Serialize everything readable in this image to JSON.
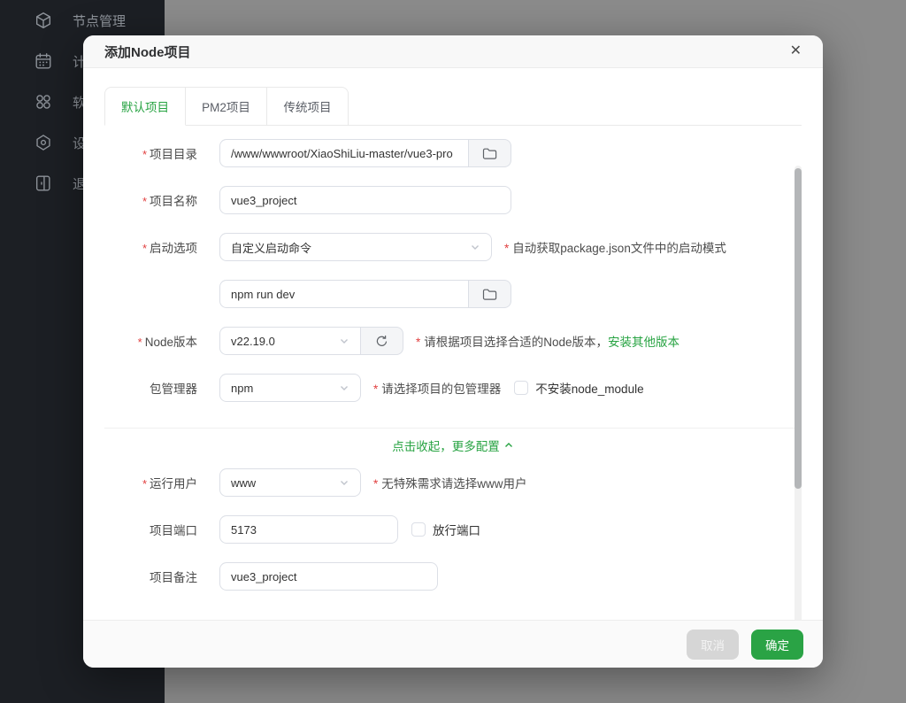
{
  "colors": {
    "accent": "#27a342",
    "required": "#e13f3f",
    "confirm_button": "#2aa345",
    "sidebar_bg": "#1c1f24"
  },
  "sidebar": {
    "items": [
      {
        "label": "节点管理",
        "icon": "cube-icon"
      },
      {
        "label": "计划",
        "icon": "calendar-icon"
      },
      {
        "label": "软件",
        "icon": "apps-icon"
      },
      {
        "label": "设置",
        "icon": "settings-icon"
      },
      {
        "label": "退出",
        "icon": "logout-icon"
      }
    ]
  },
  "modal": {
    "title": "添加Node项目",
    "close_icon": "✕",
    "required_mark": "*",
    "tabs": [
      {
        "label": "默认项目",
        "active": true
      },
      {
        "label": "PM2项目",
        "active": false
      },
      {
        "label": "传统项目",
        "active": false
      }
    ],
    "form": {
      "project_dir": {
        "label": "项目目录",
        "value": "/www/wwwroot/XiaoShiLiu-master/vue3-pro"
      },
      "project_name": {
        "label": "项目名称",
        "value": "vue3_project"
      },
      "start_option": {
        "label": "启动选项",
        "value": "自定义启动命令",
        "hint": "自动获取package.json文件中的启动模式"
      },
      "start_command": {
        "value": "npm run dev"
      },
      "node_version": {
        "label": "Node版本",
        "value": "v22.19.0",
        "hint": "请根据项目选择合适的Node版本，",
        "hint_link": "安装其他版本"
      },
      "package_manager": {
        "label": "包管理器",
        "value": "npm",
        "hint": "请选择项目的包管理器",
        "checkbox_label": "不安装node_module"
      },
      "collapse_link": "点击收起，更多配置",
      "run_user": {
        "label": "运行用户",
        "value": "www",
        "hint": "无特殊需求请选择www用户"
      },
      "project_port": {
        "label": "项目端口",
        "value": "5173",
        "checkbox_label": "放行端口"
      },
      "project_note": {
        "label": "项目备注",
        "value": "vue3_project"
      }
    },
    "footer": {
      "cancel_label": "取消",
      "confirm_label": "确定"
    }
  }
}
